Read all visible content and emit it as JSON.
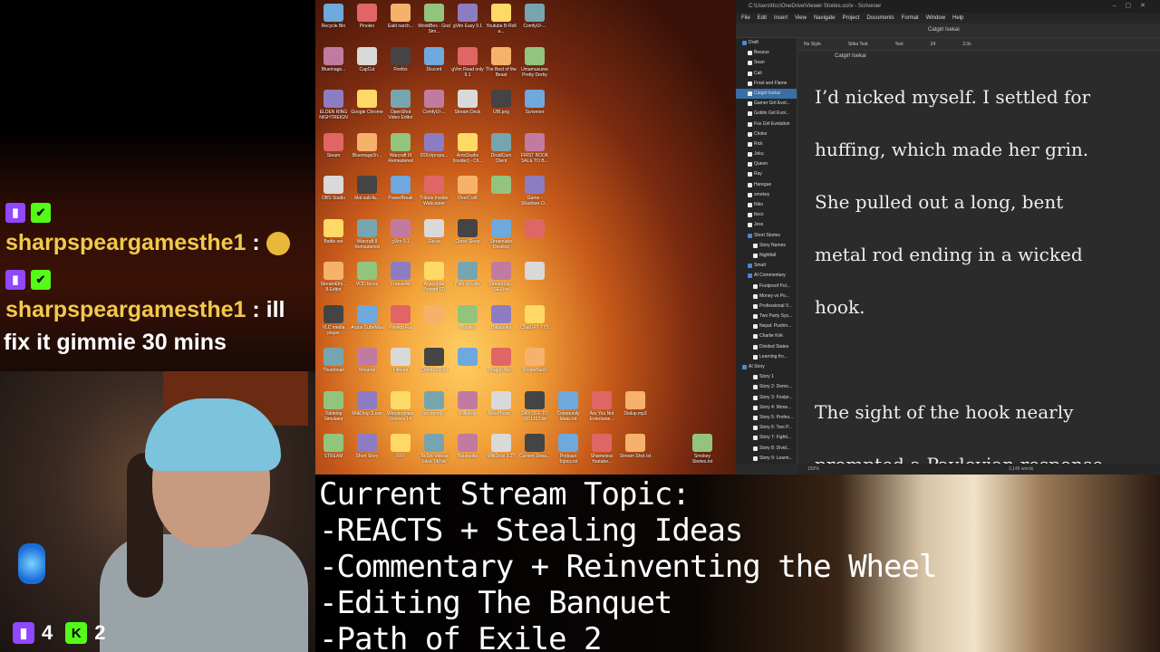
{
  "chat": {
    "messages": [
      {
        "user": "sharpspeargamesthe1",
        "text": ""
      },
      {
        "user": "sharpspeargamesthe1",
        "text": "ill",
        "text2": "fix it gimmie 30 mins"
      }
    ],
    "separator": " : "
  },
  "webcam": {
    "twitch_viewers": "4",
    "kick_viewers": "2",
    "kick_letter": "K"
  },
  "desktop": {
    "icons": [
      "Recycle Bin",
      "Pinokio",
      "Eald narch...",
      "WorldBox - God Sim...",
      "gVim Easy 9.1",
      "Youtube B-Roll a...",
      "ComfyUI-...",
      "Bluemage...",
      "CapCut",
      "Firefox",
      "Discord",
      "gVim Read only 9.1",
      "The Best of the Beast",
      "Umamusume Pretty Derby",
      "ELDEN RING NIGHTREIGN",
      "Google Chrome",
      "OpenShot Video Editor",
      "ComfyUI-...",
      "Stream Deck",
      "UBI.png",
      "Scrivener",
      "Steam",
      "Bluemage2n...",
      "Warcraft III Remastered",
      "DDUrlpropa...",
      "ArrisStudio (Insider) - Ch...",
      "DroidCam Client",
      "FIRST BOOK SALE TO B...",
      "OBS Studio",
      "Mal-sub-fa...",
      "PowerBreak",
      "Tribute Insider Webcaster",
      "OverCraft",
      "",
      "Game - Shadows O...",
      "Battle.net",
      "Warcraft II Remastered",
      "gVim 9.1",
      "Elecia",
      "Cross Sleep",
      "Streamlabs Desktop",
      "",
      "StreamElm... 8.Editor",
      "VOD.fence",
      "FreeseAir",
      "Anaconda Prompt (2)",
      "Path of Exile",
      "StreamEle... SE.Live",
      "",
      "VLC media player",
      "Argus CubeMax",
      "Pinokio Fur",
      "",
      "Pinokio",
      "Balabolka",
      "ChatGPT TTS",
      "Thumbnail",
      "Winamp",
      "Filmora",
      "Condo SD.txt",
      "",
      "Dragon Me...",
      "SimpleBatch",
      "Tabletop Simulator",
      "MilkDrop 3.exe - ...",
      "Wondershare Filmora 14",
      "run-comfy...",
      "Milkdrop",
      "NewPhone...",
      "DAY OFF TO DO LIST.txt",
      "Community Ideas.txt",
      "Are You Not Entertaine...",
      "Dialup.mp3",
      "STREAM",
      "Short Story",
      "FFV",
      "TikTok Videos Files TikTok",
      "Balabolka",
      "MilkDrop 3.27",
      "Current Strea...",
      "Podcast Topics.txt",
      "Shameless Youtube...",
      "Stream Shot.txt",
      "Smokey Stories.txt"
    ]
  },
  "scrivener": {
    "title": "C:\\Users\\ttcc\\OneDrive\\Viewer Stories.scriv - Scrivener",
    "menu": [
      "File",
      "Edit",
      "Insert",
      "View",
      "Navigate",
      "Project",
      "Documents",
      "Format",
      "Window",
      "Help"
    ],
    "toolbar_title": "Catgirl Isekai",
    "format_bar": [
      "No Style",
      "Sitka Text",
      "Text",
      "24",
      "2.0x"
    ],
    "doc_title": "Catgirl Isekai",
    "binder": [
      {
        "label": "Draft",
        "depth": 0,
        "folder": true
      },
      {
        "label": "Beezus",
        "depth": 1
      },
      {
        "label": "Sean",
        "depth": 1
      },
      {
        "label": "Cali",
        "depth": 1
      },
      {
        "label": "Frost and Flame",
        "depth": 1
      },
      {
        "label": "Catgirl Isekai",
        "depth": 1,
        "selected": true
      },
      {
        "label": "Gamer Girl Evol...",
        "depth": 1
      },
      {
        "label": "Goblin Girl Evol...",
        "depth": 1
      },
      {
        "label": "Fox Girl Evolution",
        "depth": 1
      },
      {
        "label": "Choke",
        "depth": 1
      },
      {
        "label": "Rick",
        "depth": 1
      },
      {
        "label": "Joku",
        "depth": 1
      },
      {
        "label": "Queen",
        "depth": 1
      },
      {
        "label": "Ray",
        "depth": 1
      },
      {
        "label": "Haregue",
        "depth": 1
      },
      {
        "label": "smokey",
        "depth": 1
      },
      {
        "label": "Niko",
        "depth": 1
      },
      {
        "label": "ttocs",
        "depth": 1
      },
      {
        "label": "Jess",
        "depth": 1
      },
      {
        "label": "Short Stories",
        "depth": 1,
        "folder": true
      },
      {
        "label": "Story Names",
        "depth": 2
      },
      {
        "label": "Nightfall",
        "depth": 2
      },
      {
        "label": "Smutt",
        "depth": 1,
        "folder": true
      },
      {
        "label": "AI Commentary",
        "depth": 1,
        "folder": true
      },
      {
        "label": "Foolproof Pol...",
        "depth": 2
      },
      {
        "label": "Money vs Po...",
        "depth": 2
      },
      {
        "label": "Professional V...",
        "depth": 2
      },
      {
        "label": "Two Party Sys...",
        "depth": 2
      },
      {
        "label": "Nepal: Pushin...",
        "depth": 2
      },
      {
        "label": "Charlie Kirk",
        "depth": 2
      },
      {
        "label": "Divided States",
        "depth": 2
      },
      {
        "label": "Learning fro...",
        "depth": 2
      },
      {
        "label": "AI Story",
        "depth": 0,
        "folder": true
      },
      {
        "label": "Story 1",
        "depth": 2
      },
      {
        "label": "Story 2: Demo...",
        "depth": 2
      },
      {
        "label": "Story 3: Foolpr...",
        "depth": 2
      },
      {
        "label": "Story 4: Mone...",
        "depth": 2
      },
      {
        "label": "Story 5: Profes...",
        "depth": 2
      },
      {
        "label": "Story 6: Two P...",
        "depth": 2
      },
      {
        "label": "Story 7: Fighti...",
        "depth": 2
      },
      {
        "label": "Story 8: Divid...",
        "depth": 2
      },
      {
        "label": "Story 9: Learni...",
        "depth": 2
      }
    ],
    "paragraphs": [
      "I’d nicked myself. I settled for",
      "huffing, which made her grin.",
      "She pulled out a long, bent",
      "metal rod ending in a wicked",
      "hook.",
      "",
      "The sight of the hook nearly",
      "prompted a Pavlovian response"
    ],
    "zoom": "150%",
    "word_count": "3,145 words"
  },
  "topic": {
    "lines": [
      "Current Stream Topic:",
      "-REACTS + Stealing Ideas",
      "-Commentary + Reinventing the Wheel",
      "-Editing The Banquet",
      "-Path of Exile 2"
    ]
  },
  "colors": {
    "twitch": "#9146ff",
    "kick": "#53fc18",
    "chat_user": "#f2c94c",
    "binder_selected": "#3a6ea5"
  }
}
